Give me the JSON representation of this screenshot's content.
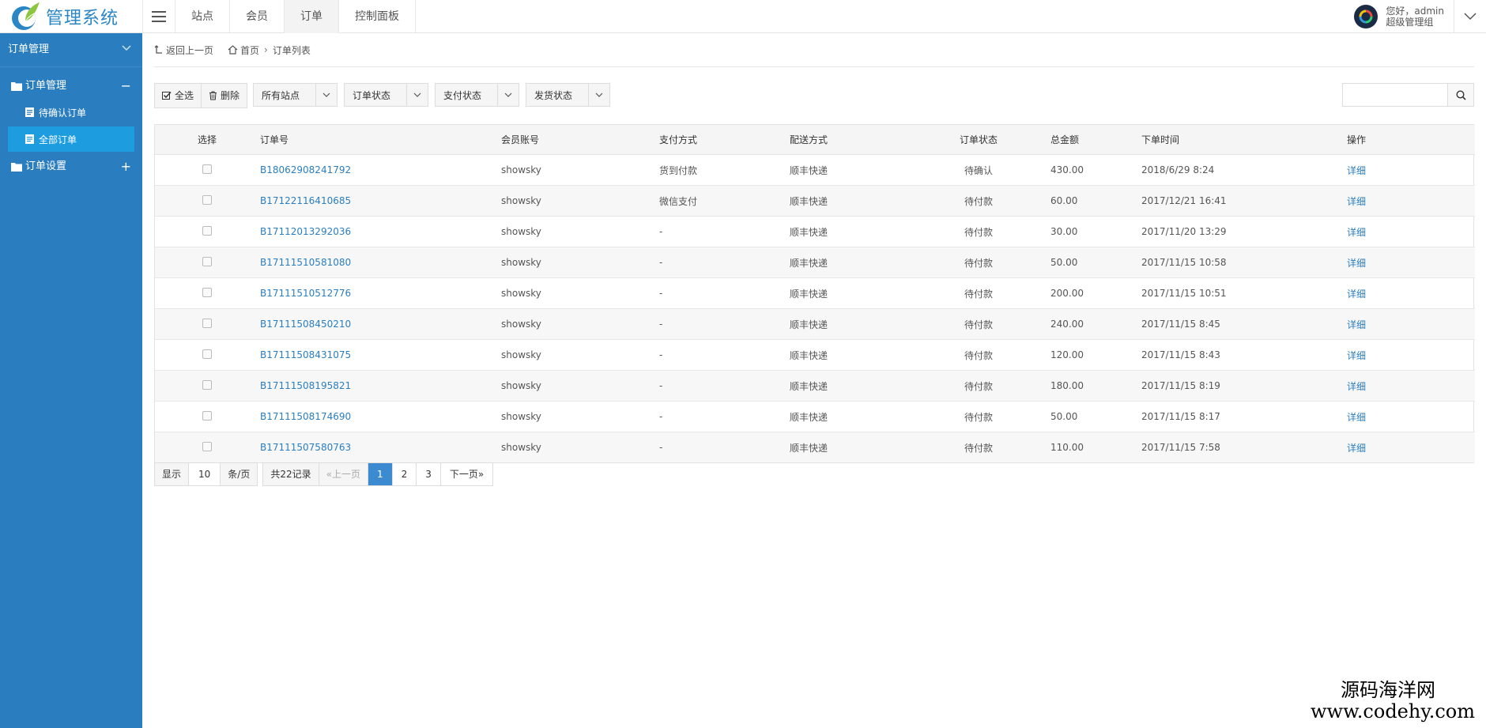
{
  "app": {
    "title": "管理系统"
  },
  "topnav": {
    "items": [
      {
        "label": "站点"
      },
      {
        "label": "会员"
      },
      {
        "label": "订单",
        "active": true
      },
      {
        "label": "控制面板"
      }
    ]
  },
  "user": {
    "greeting": "您好，admin",
    "role": "超级管理组"
  },
  "sidebar": {
    "header": "订单管理",
    "groups": [
      {
        "label": "订单管理",
        "sign": "−",
        "items": [
          {
            "label": "待确认订单"
          },
          {
            "label": "全部订单",
            "active": true
          }
        ]
      },
      {
        "label": "订单设置",
        "sign": "+"
      }
    ]
  },
  "breadcrumb": {
    "back": "返回上一页",
    "home": "首页",
    "current": "订单列表"
  },
  "toolbar": {
    "select_all": "全选",
    "delete": "删除",
    "filters": [
      "所有站点",
      "订单状态",
      "支付状态",
      "发货状态"
    ]
  },
  "search": {
    "placeholder": ""
  },
  "table": {
    "columns": [
      "选择",
      "订单号",
      "会员账号",
      "支付方式",
      "配送方式",
      "订单状态",
      "总金额",
      "下单时间",
      "操作"
    ],
    "rows": [
      {
        "order_no": "B18062908241792",
        "member": "showsky",
        "payment": "货到付款",
        "delivery": "顺丰快递",
        "status": "待确认",
        "amount": "430.00",
        "time": "2018/6/29 8:24",
        "action": "详细"
      },
      {
        "order_no": "B17122116410685",
        "member": "showsky",
        "payment": "微信支付",
        "delivery": "顺丰快递",
        "status": "待付款",
        "amount": "60.00",
        "time": "2017/12/21 16:41",
        "action": "详细"
      },
      {
        "order_no": "B17112013292036",
        "member": "showsky",
        "payment": "-",
        "delivery": "顺丰快递",
        "status": "待付款",
        "amount": "30.00",
        "time": "2017/11/20 13:29",
        "action": "详细"
      },
      {
        "order_no": "B17111510581080",
        "member": "showsky",
        "payment": "-",
        "delivery": "顺丰快递",
        "status": "待付款",
        "amount": "50.00",
        "time": "2017/11/15 10:58",
        "action": "详细"
      },
      {
        "order_no": "B17111510512776",
        "member": "showsky",
        "payment": "-",
        "delivery": "顺丰快递",
        "status": "待付款",
        "amount": "200.00",
        "time": "2017/11/15 10:51",
        "action": "详细"
      },
      {
        "order_no": "B17111508450210",
        "member": "showsky",
        "payment": "-",
        "delivery": "顺丰快递",
        "status": "待付款",
        "amount": "240.00",
        "time": "2017/11/15 8:45",
        "action": "详细"
      },
      {
        "order_no": "B17111508431075",
        "member": "showsky",
        "payment": "-",
        "delivery": "顺丰快递",
        "status": "待付款",
        "amount": "120.00",
        "time": "2017/11/15 8:43",
        "action": "详细"
      },
      {
        "order_no": "B17111508195821",
        "member": "showsky",
        "payment": "-",
        "delivery": "顺丰快递",
        "status": "待付款",
        "amount": "180.00",
        "time": "2017/11/15 8:19",
        "action": "详细"
      },
      {
        "order_no": "B17111508174690",
        "member": "showsky",
        "payment": "-",
        "delivery": "顺丰快递",
        "status": "待付款",
        "amount": "50.00",
        "time": "2017/11/15 8:17",
        "action": "详细"
      },
      {
        "order_no": "B17111507580763",
        "member": "showsky",
        "payment": "-",
        "delivery": "顺丰快递",
        "status": "待付款",
        "amount": "110.00",
        "time": "2017/11/15 7:58",
        "action": "详细"
      }
    ]
  },
  "pager": {
    "show": "显示",
    "page_size": "10",
    "per_page": "条/页",
    "total": "共22记录",
    "prev": "«上一页",
    "pages": [
      "1",
      "2",
      "3"
    ],
    "current": "1",
    "next": "下一页»"
  },
  "watermark": {
    "cn": "源码海洋网",
    "url": "www.codehy.com"
  },
  "colors": {
    "sidebar": "#2a7ebf",
    "sidebar_active": "#1e9ce0",
    "link": "#2a7ebf",
    "pager_current": "#3c8bd0"
  }
}
